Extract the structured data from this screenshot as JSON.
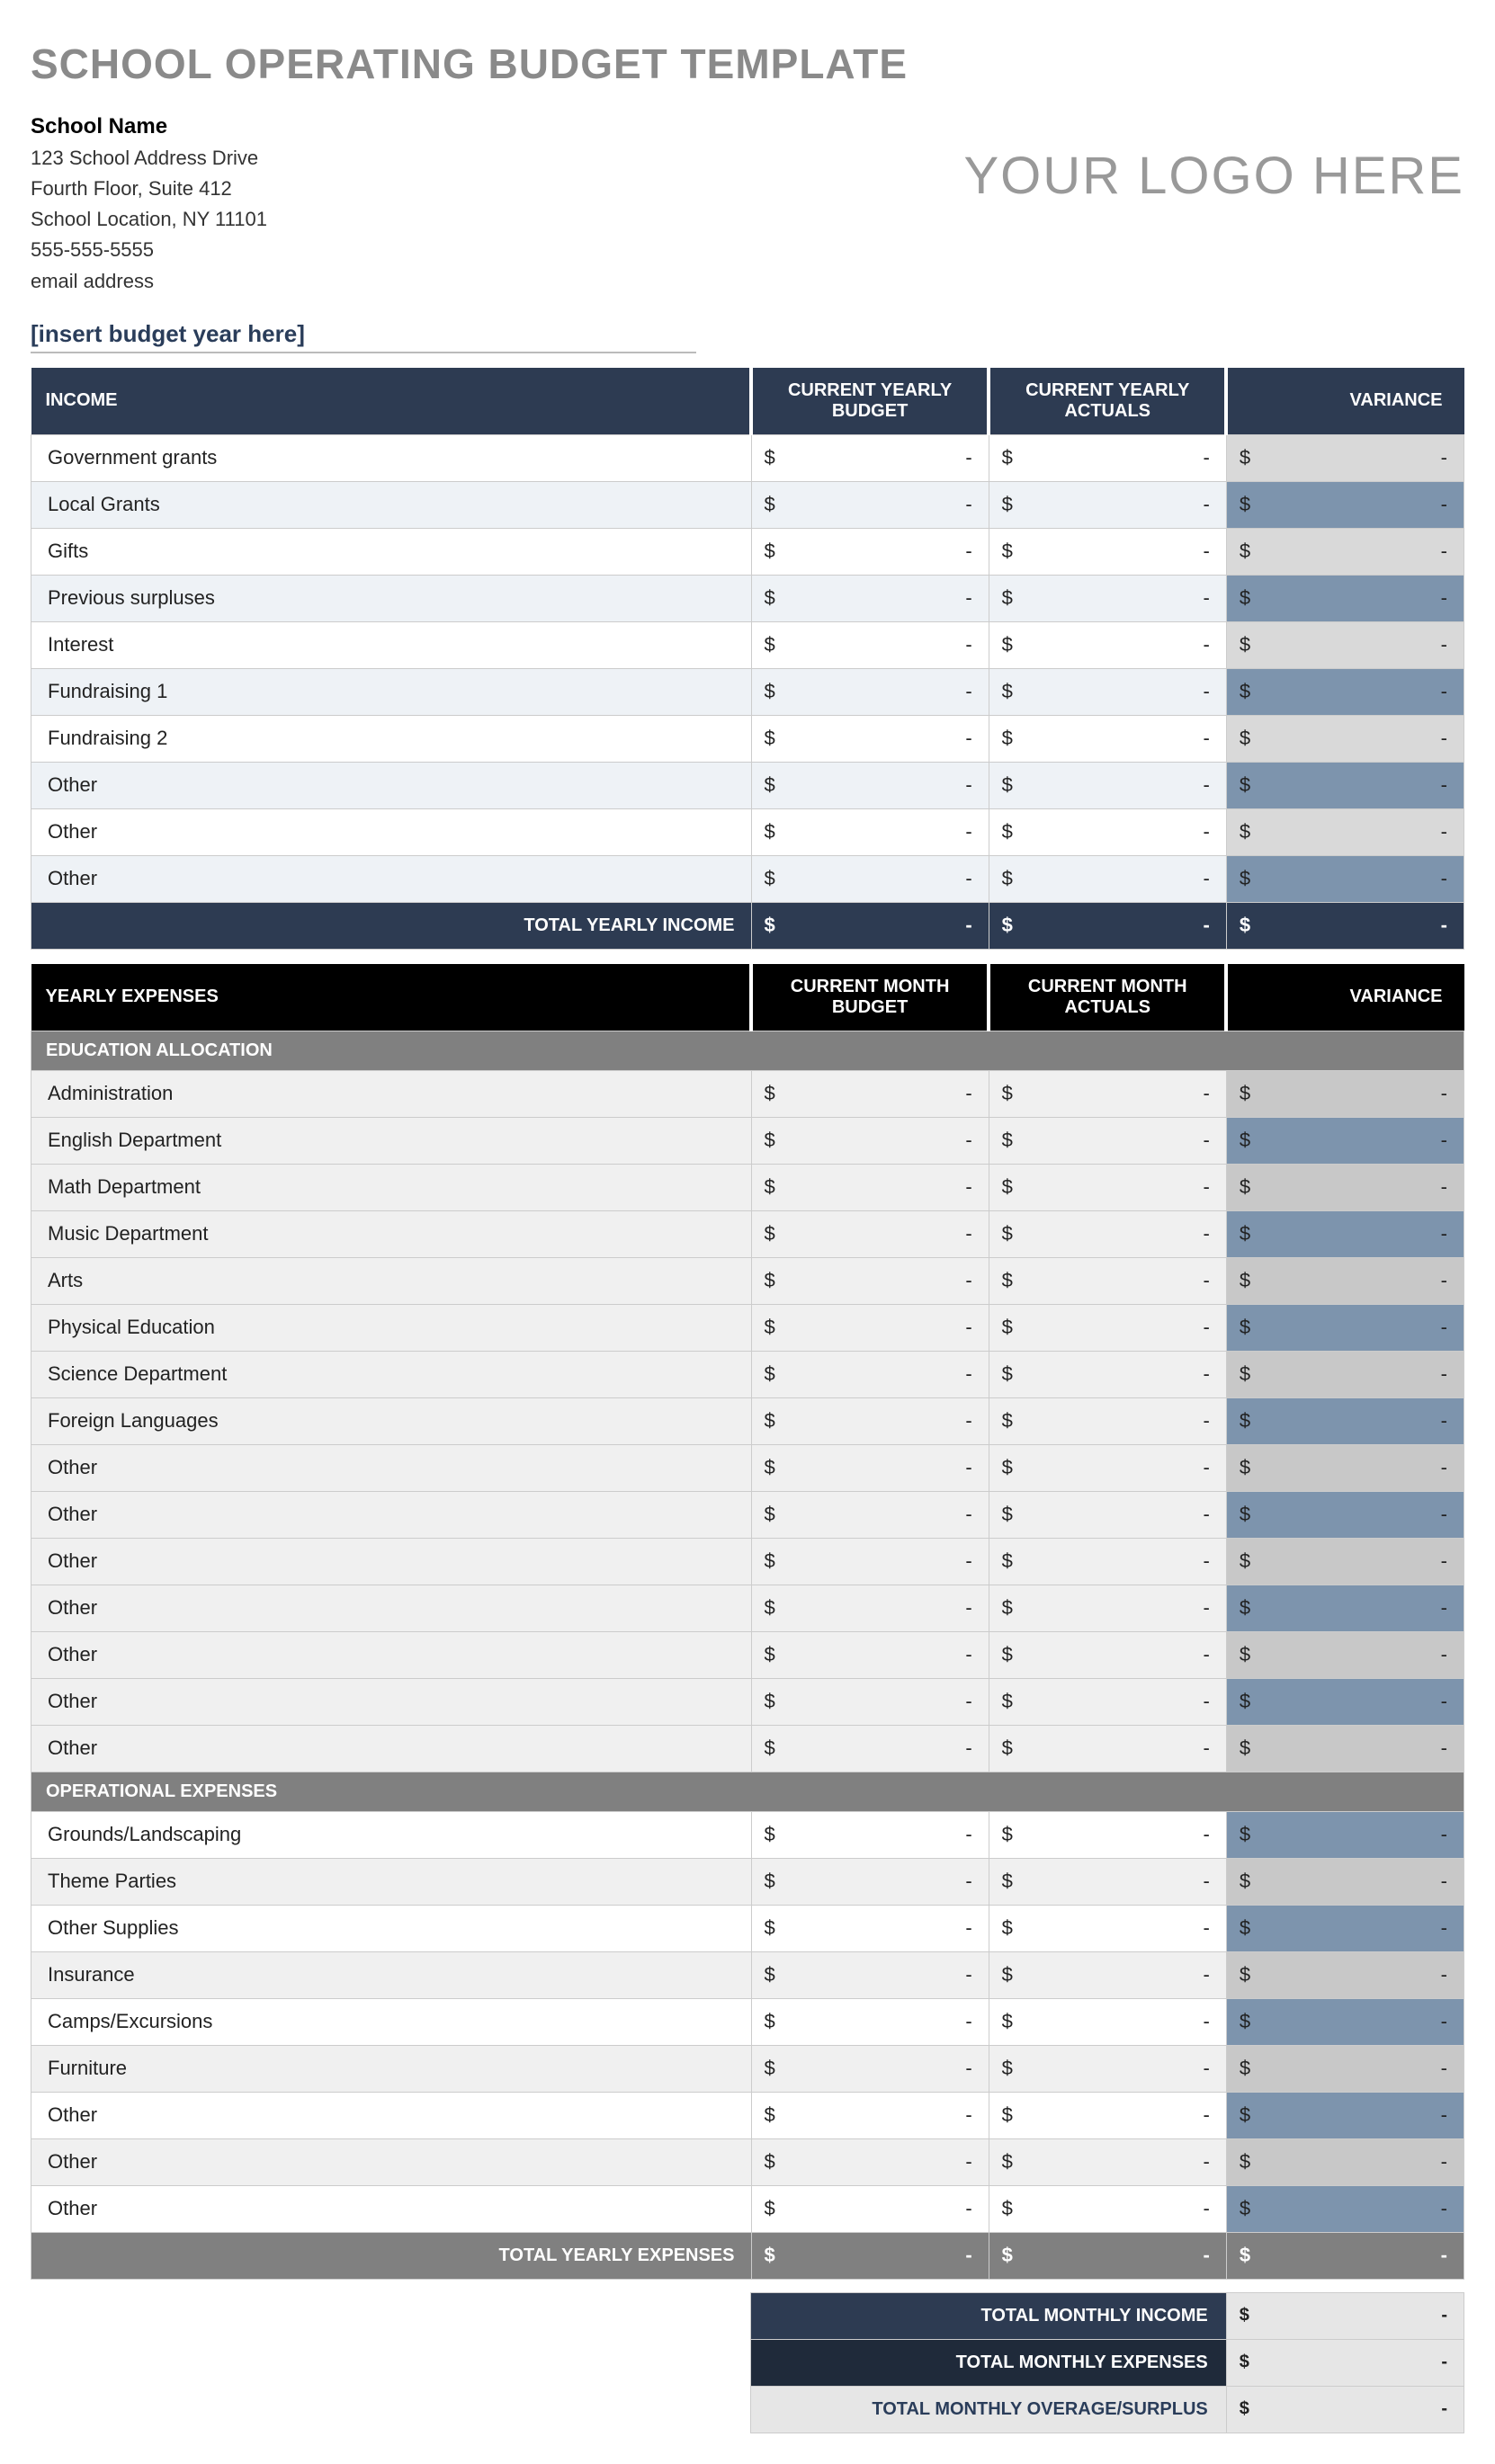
{
  "title": "SCHOOL OPERATING BUDGET TEMPLATE",
  "school": {
    "name": "School Name",
    "addr1": "123 School Address Drive",
    "addr2": "Fourth Floor, Suite 412",
    "addr3": "School Location, NY  11101",
    "phone": "555-555-5555",
    "email": "email address"
  },
  "logo_text": "YOUR LOGO HERE",
  "budget_year": "[insert budget year here]",
  "income": {
    "header": {
      "label": "INCOME",
      "c1": "CURRENT YEARLY BUDGET",
      "c2": "CURRENT YEARLY ACTUALS",
      "c3": "VARIANCE"
    },
    "rows": [
      {
        "label": "Government grants",
        "b": "-",
        "a": "-",
        "v": "-"
      },
      {
        "label": "Local Grants",
        "b": "-",
        "a": "-",
        "v": "-"
      },
      {
        "label": "Gifts",
        "b": "-",
        "a": "-",
        "v": "-"
      },
      {
        "label": "Previous surpluses",
        "b": "-",
        "a": "-",
        "v": "-"
      },
      {
        "label": "Interest",
        "b": "-",
        "a": "-",
        "v": "-"
      },
      {
        "label": "Fundraising 1",
        "b": "-",
        "a": "-",
        "v": "-"
      },
      {
        "label": "Fundraising 2",
        "b": "-",
        "a": "-",
        "v": "-"
      },
      {
        "label": "Other",
        "b": "-",
        "a": "-",
        "v": "-"
      },
      {
        "label": "Other",
        "b": "-",
        "a": "-",
        "v": "-"
      },
      {
        "label": "Other",
        "b": "-",
        "a": "-",
        "v": "-"
      }
    ],
    "total": {
      "label": "TOTAL YEARLY INCOME",
      "b": "-",
      "a": "-",
      "v": "-"
    }
  },
  "expenses": {
    "header": {
      "label": "YEARLY EXPENSES",
      "c1": "CURRENT MONTH BUDGET",
      "c2": "CURRENT MONTH ACTUALS",
      "c3": "VARIANCE"
    },
    "section1": "EDUCATION ALLOCATION",
    "edu_rows": [
      {
        "label": "Administration",
        "b": "-",
        "a": "-",
        "v": "-"
      },
      {
        "label": "English Department",
        "b": "-",
        "a": "-",
        "v": "-"
      },
      {
        "label": "Math Department",
        "b": "-",
        "a": "-",
        "v": "-"
      },
      {
        "label": "Music Department",
        "b": "-",
        "a": "-",
        "v": "-"
      },
      {
        "label": "Arts",
        "b": "-",
        "a": "-",
        "v": "-"
      },
      {
        "label": "Physical Education",
        "b": "-",
        "a": "-",
        "v": "-"
      },
      {
        "label": "Science Department",
        "b": "-",
        "a": "-",
        "v": "-"
      },
      {
        "label": "Foreign Languages",
        "b": "-",
        "a": "-",
        "v": "-"
      },
      {
        "label": "Other",
        "b": "-",
        "a": "-",
        "v": "-"
      },
      {
        "label": "Other",
        "b": "-",
        "a": "-",
        "v": "-"
      },
      {
        "label": "Other",
        "b": "-",
        "a": "-",
        "v": "-"
      },
      {
        "label": "Other",
        "b": "-",
        "a": "-",
        "v": "-"
      },
      {
        "label": "Other",
        "b": "-",
        "a": "-",
        "v": "-"
      },
      {
        "label": "Other",
        "b": "-",
        "a": "-",
        "v": "-"
      },
      {
        "label": "Other",
        "b": "-",
        "a": "-",
        "v": "-"
      }
    ],
    "section2": "OPERATIONAL EXPENSES",
    "op_rows": [
      {
        "label": "Grounds/Landscaping",
        "b": "-",
        "a": "-",
        "v": "-"
      },
      {
        "label": "Theme Parties",
        "b": "-",
        "a": "-",
        "v": "-"
      },
      {
        "label": "Other Supplies",
        "b": "-",
        "a": "-",
        "v": "-"
      },
      {
        "label": "Insurance",
        "b": "-",
        "a": "-",
        "v": "-"
      },
      {
        "label": "Camps/Excursions",
        "b": "-",
        "a": "-",
        "v": "-"
      },
      {
        "label": "Furniture",
        "b": "-",
        "a": "-",
        "v": "-"
      },
      {
        "label": "Other",
        "b": "-",
        "a": "-",
        "v": "-"
      },
      {
        "label": "Other",
        "b": "-",
        "a": "-",
        "v": "-"
      },
      {
        "label": "Other",
        "b": "-",
        "a": "-",
        "v": "-"
      }
    ],
    "total": {
      "label": "TOTAL YEARLY EXPENSES",
      "b": "-",
      "a": "-",
      "v": "-"
    }
  },
  "summary": {
    "income": {
      "label": "TOTAL MONTHLY INCOME",
      "v": "-"
    },
    "expenses": {
      "label": "TOTAL MONTHLY EXPENSES",
      "v": "-"
    },
    "overage": {
      "label": "TOTAL MONTHLY OVERAGE/SURPLUS",
      "v": "-"
    }
  },
  "currency": "$"
}
